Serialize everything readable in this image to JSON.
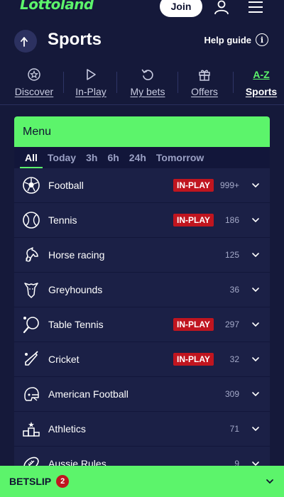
{
  "header": {
    "logo": "Lottoland",
    "join_label": "Join"
  },
  "page": {
    "title": "Sports",
    "help_label": "Help guide"
  },
  "nav": {
    "items": [
      {
        "label": "Discover",
        "icon": "star-circle-icon"
      },
      {
        "label": "In-Play",
        "icon": "play-icon"
      },
      {
        "label": "My bets",
        "icon": "history-icon"
      },
      {
        "label": "Offers",
        "icon": "gift-icon"
      },
      {
        "label": "Sports",
        "icon": "a-z-icon",
        "icon_text": "A-Z",
        "active": true
      }
    ]
  },
  "menu": {
    "title": "Menu",
    "filters": [
      "All",
      "Today",
      "3h",
      "6h",
      "24h",
      "Tomorrow"
    ],
    "active_filter": "All",
    "inplay_label": "IN-PLAY",
    "sports": [
      {
        "name": "Football",
        "count": "999+",
        "inplay": true,
        "icon": "football-icon"
      },
      {
        "name": "Tennis",
        "count": "186",
        "inplay": true,
        "icon": "tennis-icon"
      },
      {
        "name": "Horse racing",
        "count": "125",
        "inplay": false,
        "icon": "horse-racing-icon"
      },
      {
        "name": "Greyhounds",
        "count": "36",
        "inplay": false,
        "icon": "greyhound-icon"
      },
      {
        "name": "Table Tennis",
        "count": "297",
        "inplay": true,
        "icon": "table-tennis-icon"
      },
      {
        "name": "Cricket",
        "count": "32",
        "inplay": true,
        "icon": "cricket-icon"
      },
      {
        "name": "American Football",
        "count": "309",
        "inplay": false,
        "icon": "american-football-icon"
      },
      {
        "name": "Athletics",
        "count": "71",
        "inplay": false,
        "icon": "athletics-icon"
      },
      {
        "name": "Aussie Rules",
        "count": "9",
        "inplay": false,
        "icon": "aussie-rules-icon"
      }
    ]
  },
  "betslip": {
    "label": "BETSLIP",
    "count": "2"
  },
  "colors": {
    "background": "#15193a",
    "accent": "#5cf46b",
    "inplay": "#c0151f",
    "card": "#1b2046"
  }
}
